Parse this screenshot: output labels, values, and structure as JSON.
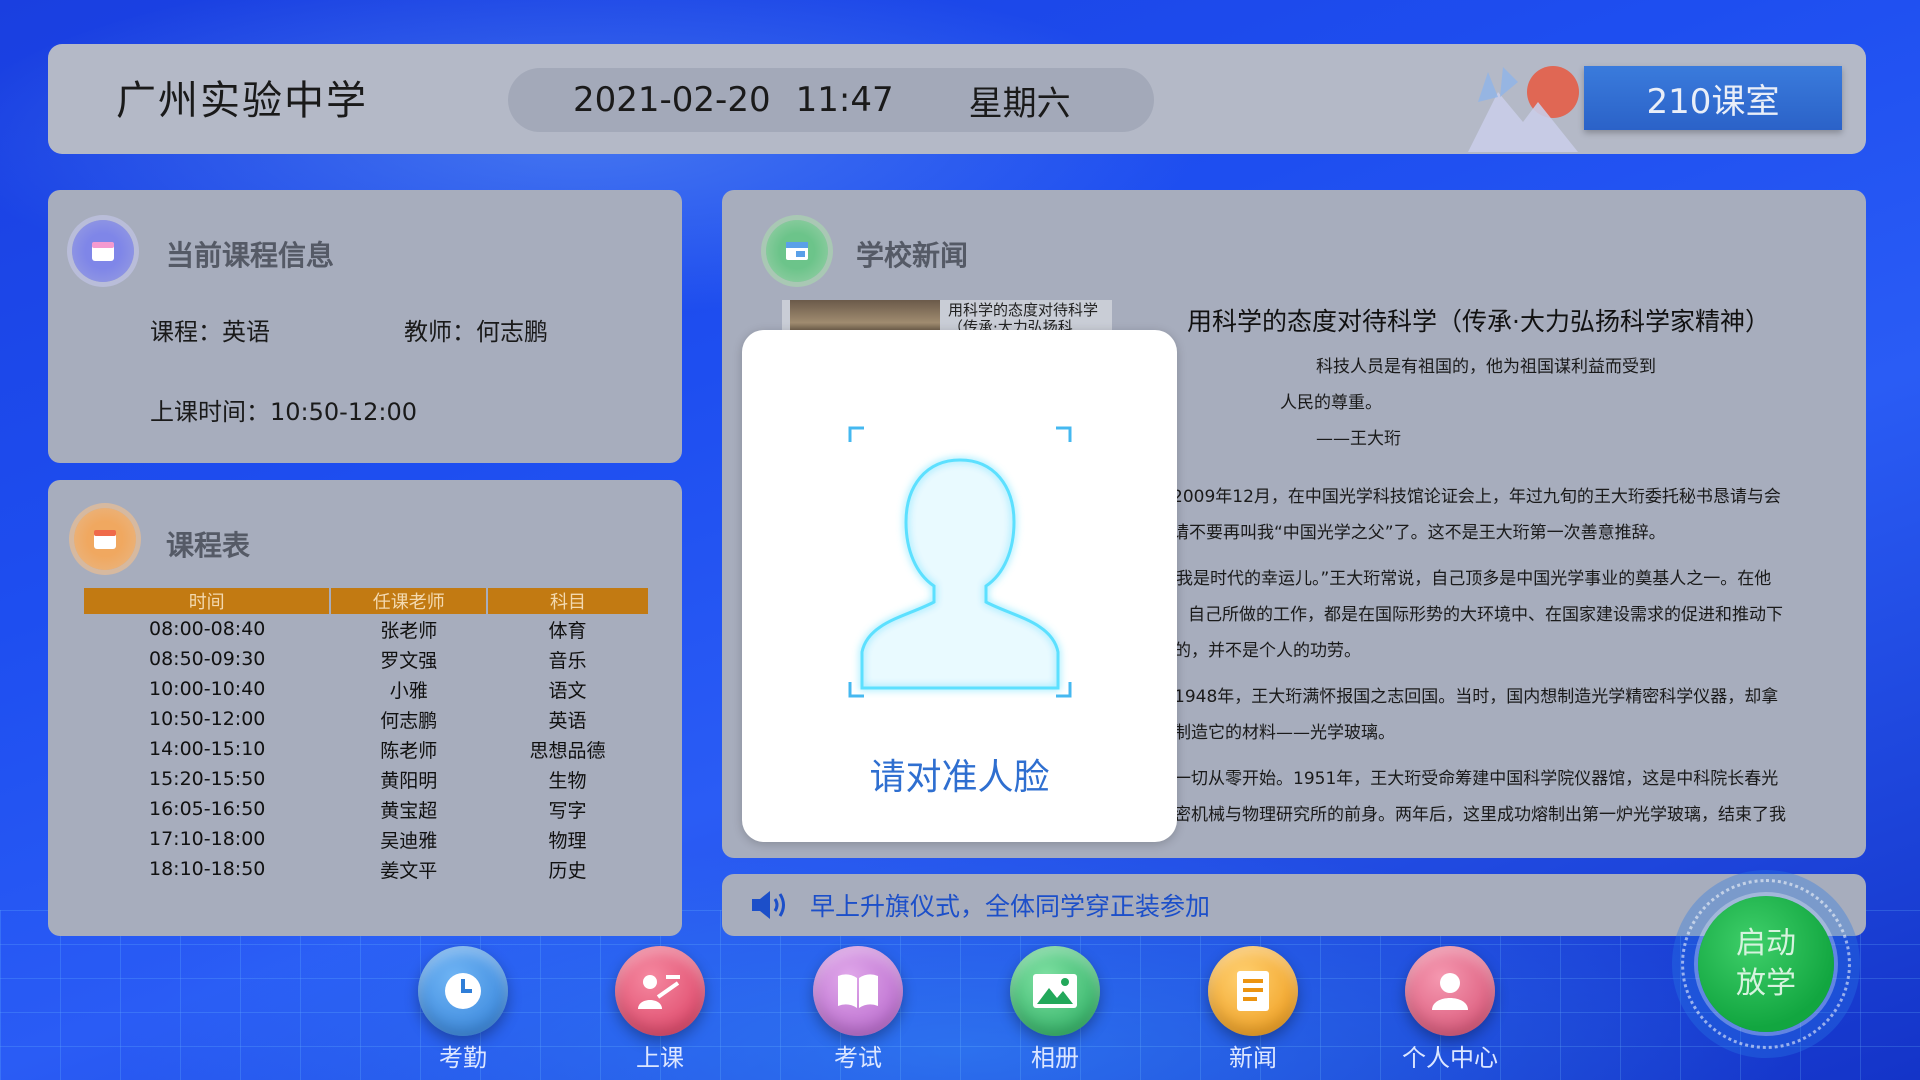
{
  "header": {
    "school_name": "广州实验中学",
    "date": "2021-02-20",
    "time": "11:47",
    "weekday": "星期六",
    "classroom": "210课室"
  },
  "course_info": {
    "title": "当前课程信息",
    "course_label": "课程：英语",
    "teacher_label": "教师：何志鹏",
    "time_label": "上课时间：10:50-12:00"
  },
  "schedule": {
    "title": "课程表",
    "columns": [
      "时间",
      "任课老师",
      "科目"
    ],
    "rows": [
      [
        "08:00-08:40",
        "张老师",
        "体育"
      ],
      [
        "08:50-09:30",
        "罗文强",
        "音乐"
      ],
      [
        "10:00-10:40",
        "小雅",
        "语文"
      ],
      [
        "10:50-12:00",
        "何志鹏",
        "英语"
      ],
      [
        "14:00-15:10",
        "陈老师",
        "思想品德"
      ],
      [
        "15:20-15:50",
        "黄阳明",
        "生物"
      ],
      [
        "16:05-16:50",
        "黄宝超",
        "写字"
      ],
      [
        "17:10-18:00",
        "吴迪雅",
        "物理"
      ],
      [
        "18:10-18:50",
        "姜文平",
        "历史"
      ]
    ]
  },
  "news": {
    "title": "学校新闻",
    "thumb_caption": "用科学的态度对待科学（传承·大力弘扬科",
    "headline": "用科学的态度对待科学（传承·大力弘扬科学家精神）",
    "quote_line1": "科技人员是有祖国的，他为祖国谋利益而受到",
    "quote_line2": "人民的尊重。",
    "quote_author": "——王大珩",
    "p1_line1": "2009年12月，在中国光学科技馆论证会上，年过九旬的王大珩委托秘书恳请与会",
    "p1_line2": "请不要再叫我“中国光学之父”了。这不是王大珩第一次善意推辞。",
    "p2_line1": "我是时代的幸运儿。”王大珩常说，自己顶多是中国光学事业的奠基人之一。在他",
    "p2_line2": "自己所做的工作，都是在国际形势的大环境中、在国家建设需求的促进和推动下",
    "p2_line3": "的，并不是个人的功劳。",
    "p3_line1": "1948年，王大珩满怀报国之志回国。当时，国内想制造光学精密科学仪器，却拿",
    "p3_line2": "制造它的材料——光学玻璃。",
    "p4_line1": "一切从零开始。1951年，王大珩受命筹建中国科学院仪器馆，这是中科院长春光",
    "p4_line2": "密机械与物理研究所的前身。两年后，这里成功熔制出第一炉光学玻璃，结束了我"
  },
  "notice": {
    "text": "早上升旗仪式，全体同学穿正装参加"
  },
  "face_modal": {
    "prompt": "请对准人脸"
  },
  "nav": [
    {
      "label": "考勤",
      "icon": "clock-icon",
      "color": "#3a8ee8"
    },
    {
      "label": "上课",
      "icon": "teacher-icon",
      "color": "#e24a6a"
    },
    {
      "label": "考试",
      "icon": "book-icon",
      "color": "#c06fd0"
    },
    {
      "label": "相册",
      "icon": "photo-icon",
      "color": "#2fb86a"
    },
    {
      "label": "新闻",
      "icon": "news-icon",
      "color": "#f0a020"
    },
    {
      "label": "个人中心",
      "icon": "user-icon",
      "color": "#e45a7a"
    }
  ],
  "start_button": {
    "line1": "启动",
    "line2": "放学"
  },
  "colors": {
    "background": "#1e4ef0",
    "panel": "#a7adbd",
    "table_header": "#c27a12",
    "notice_text": "#1c4fc9",
    "start_button": "#12a640"
  }
}
